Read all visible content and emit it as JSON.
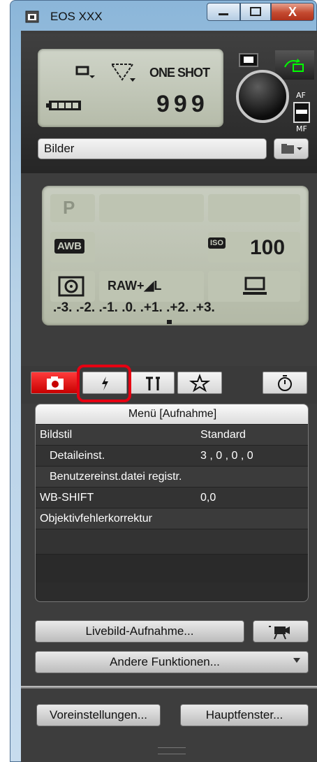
{
  "window": {
    "title": "EOS XXX",
    "close_label": "X"
  },
  "camera_status": {
    "shooting_mode": "ONE SHOT",
    "shots_remaining": "999",
    "af_label": "AF",
    "mf_label": "MF",
    "destination_folder": "Bilder"
  },
  "settings": {
    "mode": "P",
    "white_balance": "AWB",
    "iso_label": "ISO",
    "iso_value": "100",
    "image_quality": "RAW+◢L",
    "exposure_scale": ".-3. .-2. .-1. .0. .+1. .+2. .+3."
  },
  "menu": {
    "title": "Menü [Aufnahme]",
    "rows": [
      {
        "label": "Bildstil",
        "value": "Standard"
      },
      {
        "label": "Detaileinst.",
        "value": "3 , 0 , 0 , 0"
      },
      {
        "label": "Benutzereinst.datei registr.",
        "value": ""
      },
      {
        "label": "WB-SHIFT",
        "value": "0,0"
      },
      {
        "label": "Objektivfehlerkorrektur",
        "value": ""
      }
    ]
  },
  "buttons": {
    "live_view": "Livebild-Aufnahme...",
    "other_functions": "Andere Funktionen...",
    "preferences": "Voreinstellungen...",
    "main_window": "Hauptfenster..."
  },
  "colors": {
    "highlight": "#e60012",
    "active_tab": "#d40000"
  }
}
